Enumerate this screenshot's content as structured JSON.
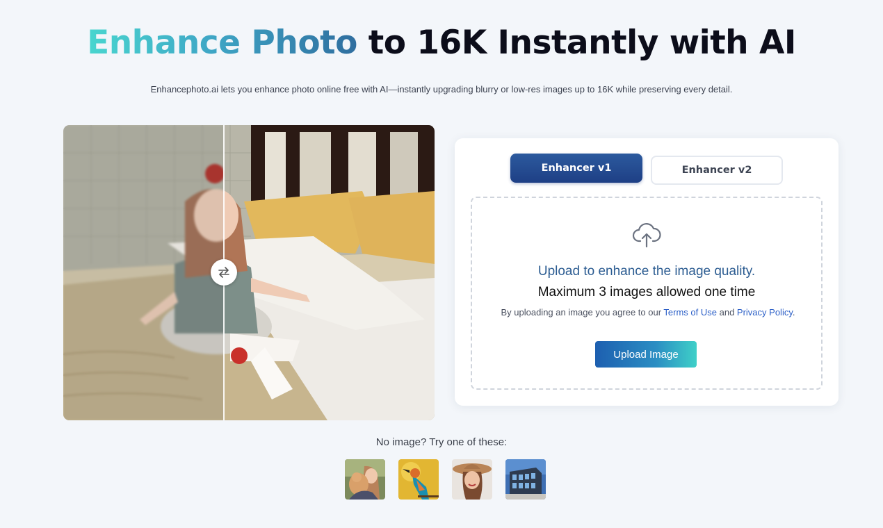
{
  "hero": {
    "title_highlight": "Enhance Photo",
    "title_rest": " to 16K Instantly with AI",
    "subtitle": "Enhancephoto.ai lets you enhance photo online free with AI—instantly upgrading blurry or low-res images up to 16K while preserving every detail."
  },
  "compare": {
    "handle_icon": "swap-arrows-icon"
  },
  "card": {
    "tabs": [
      {
        "label": "Enhancer v1",
        "active": true
      },
      {
        "label": "Enhancer v2",
        "active": false
      }
    ],
    "dropzone": {
      "icon": "cloud-upload-icon",
      "line1": "Upload to enhance the image quality.",
      "line2": "Maximum 3 images allowed one time",
      "terms_prefix": "By uploading an image you agree to our ",
      "terms_link": "Terms of Use",
      "terms_mid": " and ",
      "privacy_link": "Privacy Policy",
      "terms_suffix": ".",
      "button": "Upload Image"
    }
  },
  "samples": {
    "label": "No image? Try one of these:",
    "items": [
      "woman-with-cat",
      "kingfisher-bird",
      "woman-in-hat",
      "modern-building"
    ]
  },
  "colors": {
    "accent_dark": "#1e3f85",
    "accent_teal": "#3fd0c8",
    "link": "#2b5fc7",
    "background": "#f3f6fa"
  }
}
